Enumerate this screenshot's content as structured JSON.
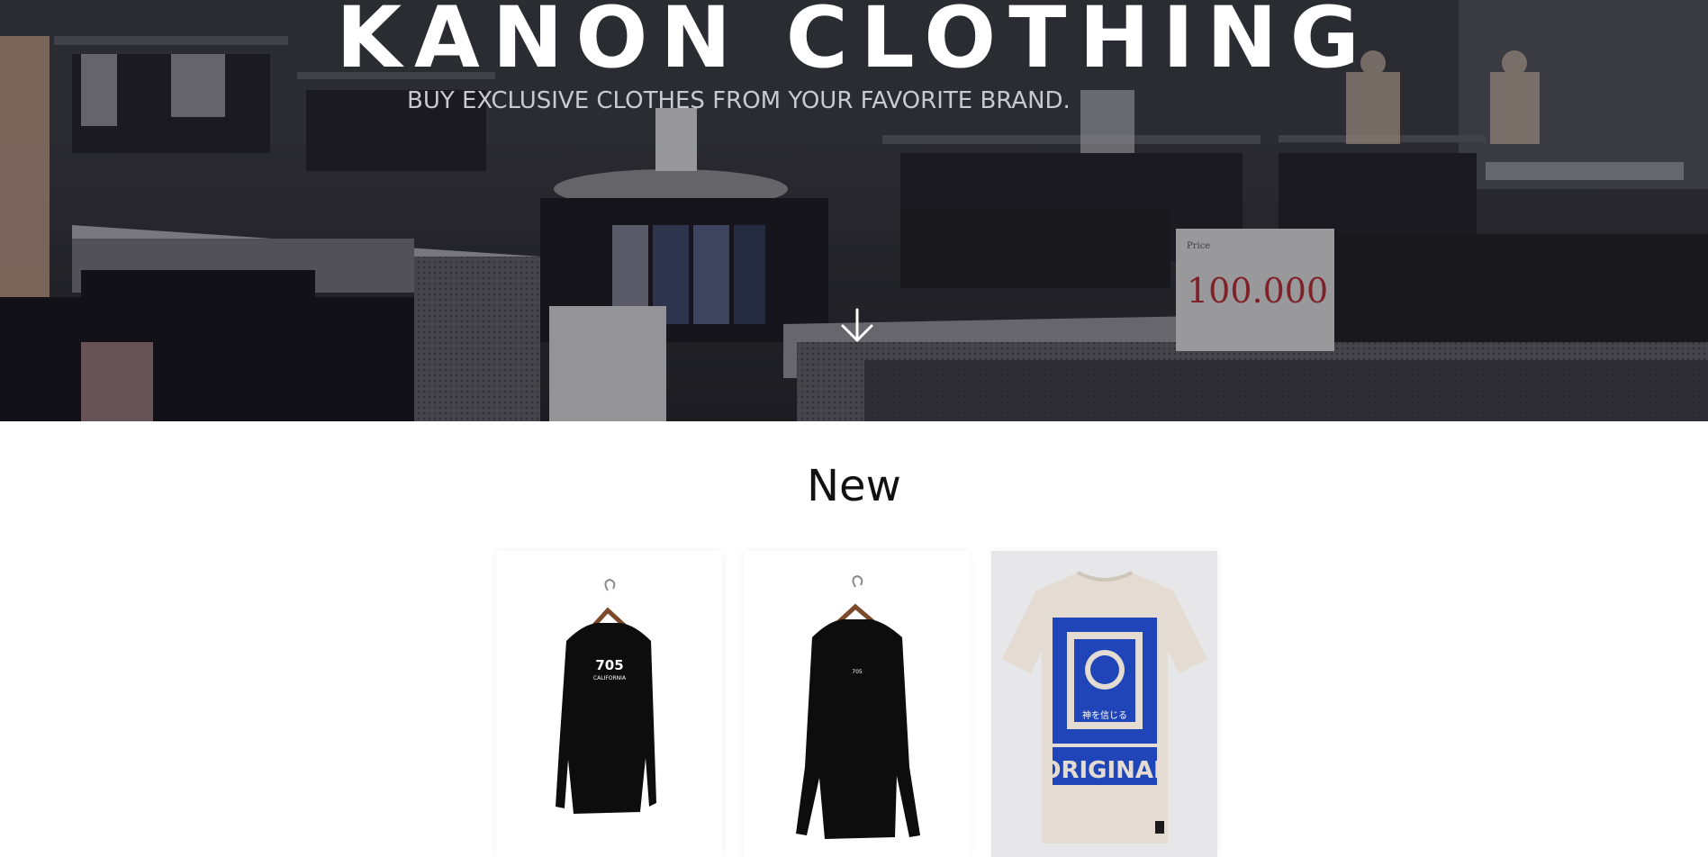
{
  "hero": {
    "brand_title": "KANON CLOTHING",
    "subtitle": "BUY EXCLUSIVE CLOTHES FROM YOUR FAVORITE BRAND.",
    "price_sign_text": "100.000",
    "scroll_icon": "arrow-down-icon"
  },
  "new_section": {
    "title": "New",
    "products": [
      {
        "print_number": "705",
        "print_text": "CALIFORNIA",
        "shirt_color": "#0d0d0d"
      },
      {
        "print_number": "705",
        "print_text": "",
        "shirt_color": "#0d0d0d"
      },
      {
        "print_text": "ORIGINAL",
        "print_subtext": "神を信じる",
        "shirt_color": "#e4dcd2",
        "print_color": "#1f45b8"
      }
    ]
  },
  "colors": {
    "hero_overlay": "#1e1e24",
    "text_dark": "#111111",
    "price_red": "#b2242b"
  }
}
